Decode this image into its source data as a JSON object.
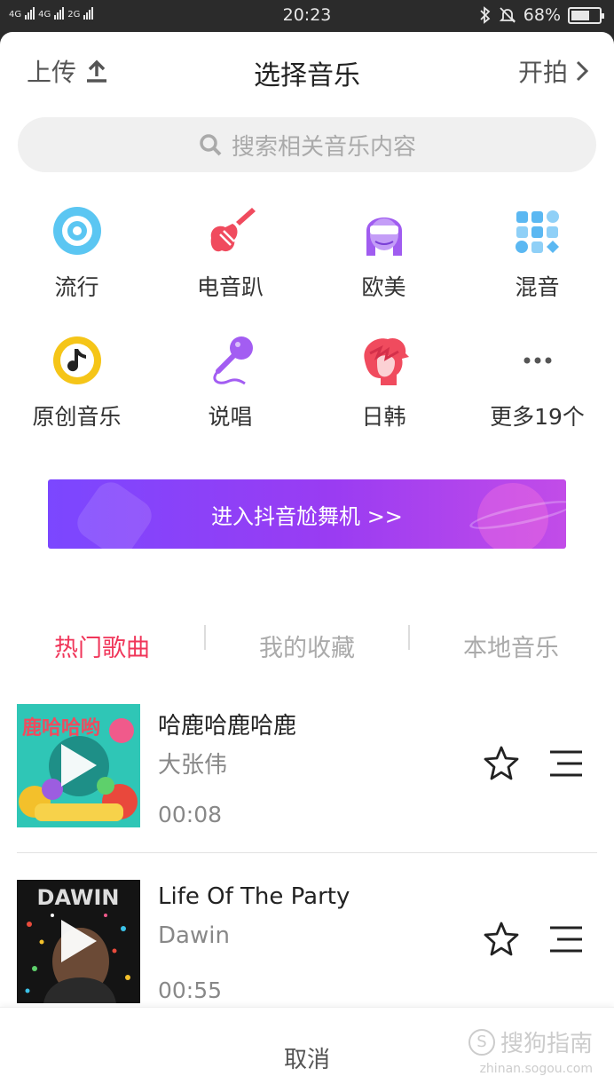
{
  "status_bar": {
    "network_1": "4G",
    "network_2": "4G",
    "network_3": "2G",
    "time": "20:23",
    "battery": "68%",
    "battery_level": 0.68
  },
  "header": {
    "upload_label": "上传",
    "title": "选择音乐",
    "shoot_label": "开拍"
  },
  "search": {
    "placeholder": "搜索相关音乐内容"
  },
  "categories": [
    {
      "label": "流行",
      "icon": "disc-icon"
    },
    {
      "label": "电音趴",
      "icon": "guitar-icon"
    },
    {
      "label": "欧美",
      "icon": "sunglasses-avatar-icon"
    },
    {
      "label": "混音",
      "icon": "grid-icon"
    },
    {
      "label": "原创音乐",
      "icon": "music-note-icon"
    },
    {
      "label": "说唱",
      "icon": "microphone-icon"
    },
    {
      "label": "日韩",
      "icon": "hair-avatar-icon"
    },
    {
      "label": "更多19个",
      "icon": "more-icon"
    }
  ],
  "banner": {
    "label": "进入抖音尬舞机 >>"
  },
  "tabs": [
    {
      "label": "热门歌曲",
      "active": true
    },
    {
      "label": "我的收藏",
      "active": false
    },
    {
      "label": "本地音乐",
      "active": false
    }
  ],
  "songs": [
    {
      "title": "哈鹿哈鹿哈鹿",
      "artist": "大张伟",
      "duration": "00:08",
      "cover_text": "鹿哈哈哟"
    },
    {
      "title": "Life Of The Party",
      "artist": "Dawin",
      "duration": "00:55",
      "cover_text": "DAWIN"
    }
  ],
  "footer": {
    "cancel_label": "取消",
    "watermark_title": "搜狗指南",
    "watermark_url": "zhinan.sogou.com"
  },
  "colors": {
    "accent_red": "#f0365a",
    "banner_purple": "#7b47ff",
    "status_bar": "#2b2b2b"
  }
}
